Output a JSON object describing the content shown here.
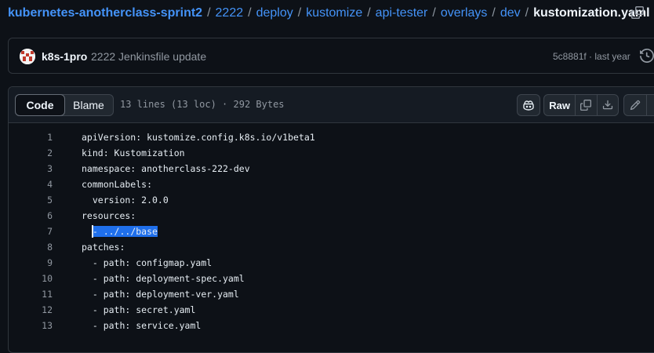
{
  "breadcrumb": {
    "repo": "kubernetes-anotherclass-sprint2",
    "segments": [
      "2222",
      "deploy",
      "kustomize",
      "api-tester",
      "overlays",
      "dev"
    ],
    "file": "kustomization.yaml"
  },
  "commit": {
    "author": "k8s-1pro",
    "message": "2222 Jenkinsfile update",
    "hash": "5c8881f",
    "separator": "·",
    "time": "last year"
  },
  "file_header": {
    "tabs": [
      "Code",
      "Blame"
    ],
    "active_tab": "Code",
    "info": "13 lines (13 loc) · 292 Bytes",
    "raw_label": "Raw"
  },
  "code_lines": [
    {
      "n": "1",
      "text": "apiVersion: kustomize.config.k8s.io/v1beta1"
    },
    {
      "n": "2",
      "text": "kind: Kustomization"
    },
    {
      "n": "3",
      "text": "namespace: anotherclass-222-dev"
    },
    {
      "n": "4",
      "text": "commonLabels:"
    },
    {
      "n": "5",
      "text": "  version: 2.0.0"
    },
    {
      "n": "6",
      "text": "resources:"
    },
    {
      "n": "7",
      "text": "- ../../base",
      "pre": "  ",
      "highlight": true
    },
    {
      "n": "8",
      "text": "patches:"
    },
    {
      "n": "9",
      "text": "  - path: configmap.yaml"
    },
    {
      "n": "10",
      "text": "  - path: deployment-spec.yaml"
    },
    {
      "n": "11",
      "text": "  - path: deployment-ver.yaml"
    },
    {
      "n": "12",
      "text": "  - path: secret.yaml"
    },
    {
      "n": "13",
      "text": "  - path: service.yaml"
    }
  ],
  "colors": {
    "background": "#0d1117",
    "link": "#4493f8",
    "selection": "#1f6feb",
    "border": "#30363d"
  }
}
